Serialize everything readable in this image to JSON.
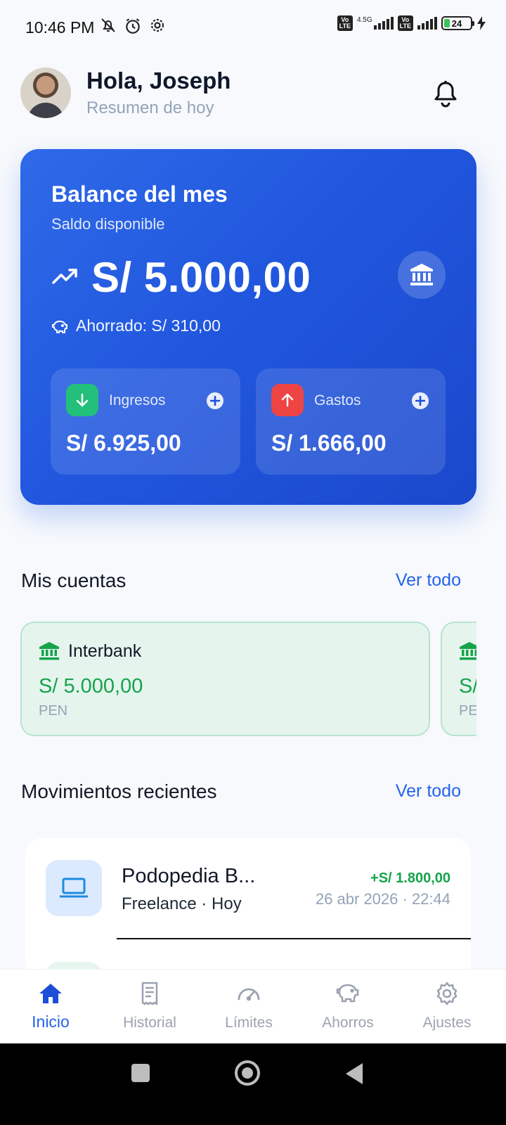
{
  "status_bar": {
    "time": "10:46",
    "ampm": "PM",
    "network_type": "4.5G",
    "volte": "Vo LTE",
    "battery": "24"
  },
  "header": {
    "greeting": "Hola, Joseph",
    "subtitle": "Resumen de hoy"
  },
  "balance": {
    "title": "Balance del mes",
    "subtitle": "Saldo disponible",
    "amount": "S/ 5.000,00",
    "saved": "Ahorrado: S/ 310,00",
    "income": {
      "label": "Ingresos",
      "amount": "S/ 6.925,00"
    },
    "expenses": {
      "label": "Gastos",
      "amount": "S/ 1.666,00"
    }
  },
  "accounts": {
    "title": "Mis cuentas",
    "see_all": "Ver todo",
    "items": [
      {
        "name": "Interbank",
        "amount": "S/ 5.000,00",
        "currency": "PEN"
      },
      {
        "name": "",
        "amount": "S/",
        "currency": "PE"
      }
    ]
  },
  "movements": {
    "title": "Movimientos recientes",
    "see_all": "Ver todo",
    "items": [
      {
        "title": "Podopedia B...",
        "subtitle": "Freelance · Hoy",
        "amount": "+S/ 1.800,00",
        "date": "26 abr 2026 · 22:44"
      }
    ]
  },
  "bottom_nav": {
    "items": [
      {
        "label": "Inicio",
        "icon": "home-icon",
        "active": true
      },
      {
        "label": "Historial",
        "icon": "receipt-icon",
        "active": false
      },
      {
        "label": "Límites",
        "icon": "gauge-icon",
        "active": false
      },
      {
        "label": "Ahorros",
        "icon": "piggy-bank-icon",
        "active": false
      },
      {
        "label": "Ajustes",
        "icon": "gear-icon",
        "active": false
      }
    ]
  },
  "colors": {
    "primary": "#2563eb",
    "card_gradient_start": "#2f6ae8",
    "card_gradient_end": "#1a48cc",
    "income": "#22c07a",
    "expense": "#ef4444",
    "positive_text": "#16a34a",
    "muted": "#94a3b8"
  }
}
